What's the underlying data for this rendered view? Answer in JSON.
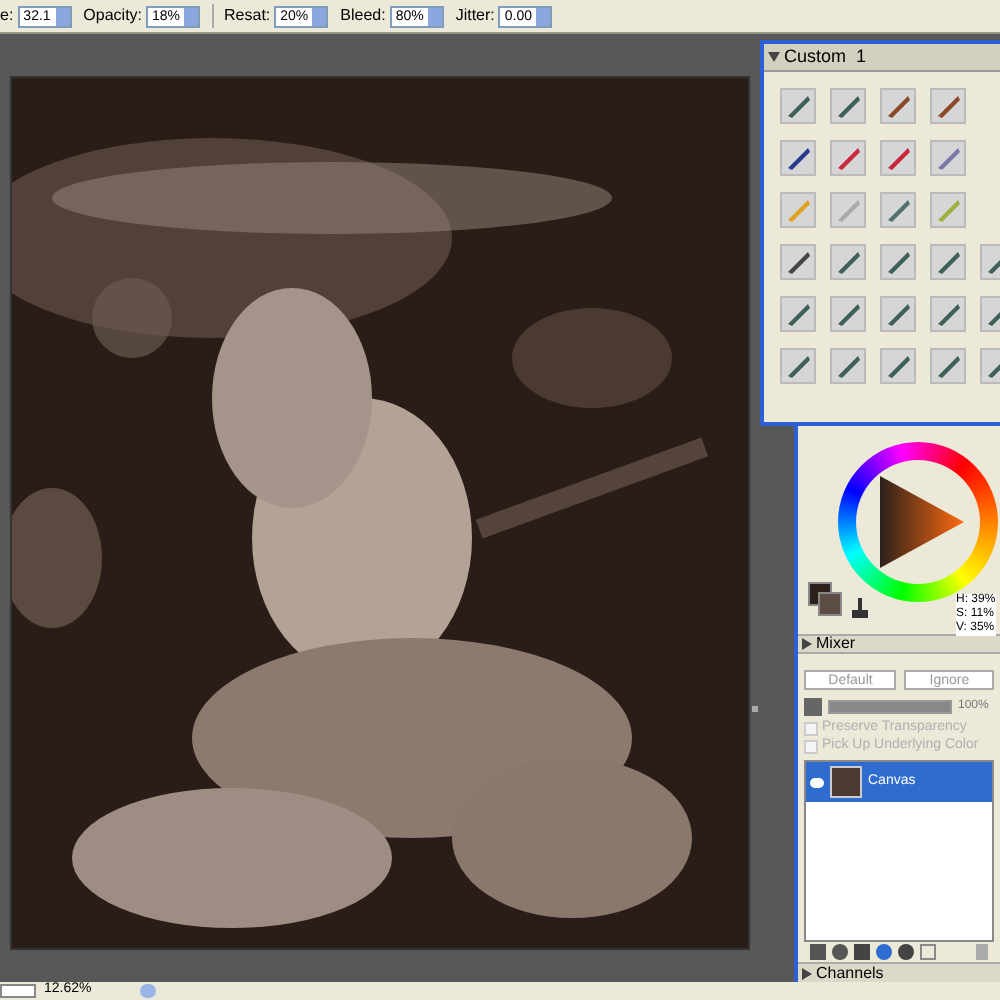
{
  "toolbar": {
    "fields": [
      {
        "label": "e:",
        "value": "32.1"
      },
      {
        "label": "Opacity:",
        "value": "18%"
      },
      {
        "label": "Resat:",
        "value": "20%"
      },
      {
        "label": "Bleed:",
        "value": "80%"
      },
      {
        "label": "Jitter:",
        "value": "0.00"
      }
    ]
  },
  "brush_palette": {
    "title": "Custom  1"
  },
  "color_panel": {
    "readouts": [
      "H: 39%",
      "S: 11%",
      "V: 35%"
    ]
  },
  "mixer": {
    "title": "Mixer",
    "expanded": false
  },
  "layers": {
    "composite_method": "Default",
    "depth": "Ignore",
    "opacity": "100%",
    "level": 1,
    "options": [
      {
        "label": "Preserve Transparency",
        "checked": false,
        "disabled": true
      },
      {
        "label": "Pick Up Underlying Color",
        "checked": false,
        "disabled": true
      }
    ],
    "items": [
      {
        "name": "Canvas",
        "selected": true,
        "visible": true
      }
    ]
  },
  "channels": {
    "title": "Channels",
    "expanded": false
  },
  "status_bar": {
    "zoom": "12.62%"
  }
}
